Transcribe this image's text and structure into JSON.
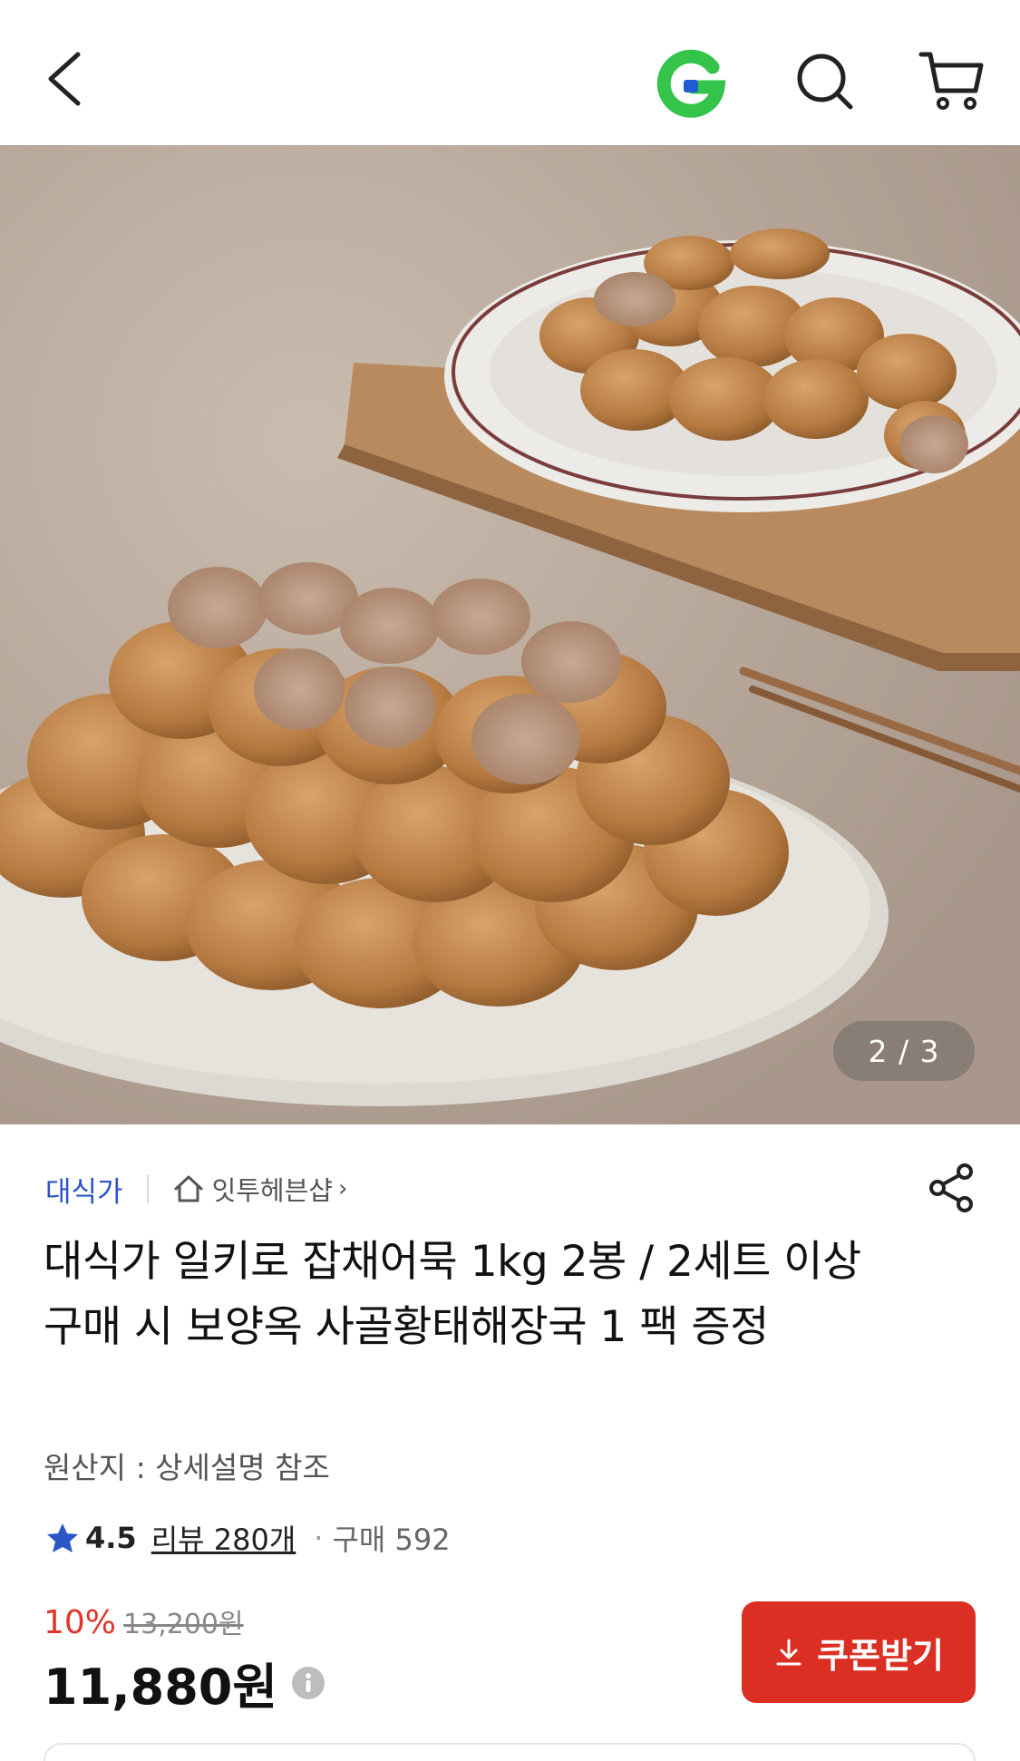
{
  "header": {
    "back_icon": "chevron-left-icon",
    "logo_icon": "g-logo-icon",
    "search_icon": "search-icon",
    "cart_icon": "cart-icon",
    "logo_colors": {
      "green": "#34c34b",
      "blue": "#1f5bd1"
    }
  },
  "hero": {
    "page_indicator": "2 / 3",
    "current_page": 2,
    "total_pages": 3
  },
  "seller": {
    "brand": "대식가",
    "shop_name": "잇투헤븐샵",
    "shop_chevron": "›"
  },
  "product": {
    "title": "대식가 일키로 잡채어묵 1kg 2봉 / 2세트 이상 구매 시 보양옥 사골황태해장국 1 팩 증정",
    "origin": "원산지 : 상세설명 참조"
  },
  "rating": {
    "score": "4.5",
    "review_label": "리뷰 280개",
    "dot": "·",
    "purchase_label": "구매 592",
    "star_color": "#2a56c6"
  },
  "price": {
    "discount": "10%",
    "original": "13,200원",
    "final": "11,880원",
    "discount_color": "#e0362b"
  },
  "coupon": {
    "label": "쿠폰받기",
    "color": "#dc2f23"
  }
}
